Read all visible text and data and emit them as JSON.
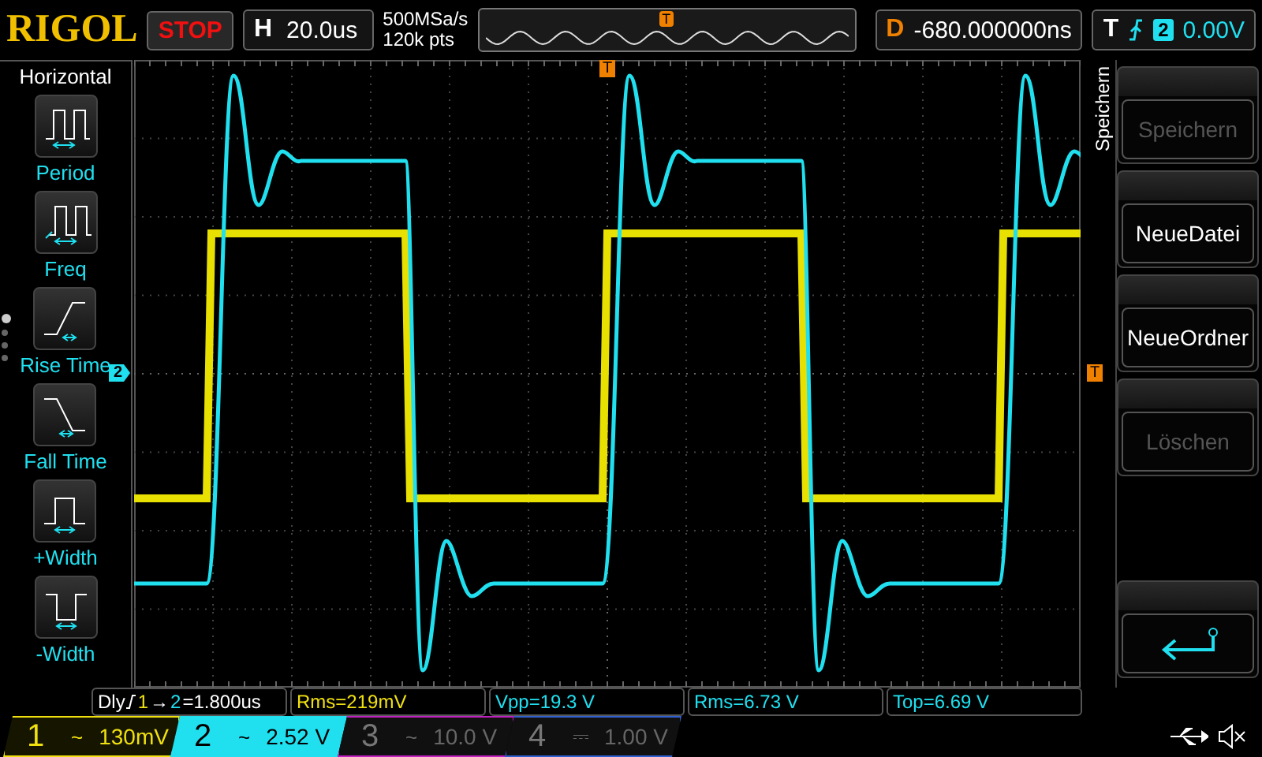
{
  "brand": "RIGOL",
  "run_state": "STOP",
  "horizontal": {
    "label": "H",
    "timebase": "20.0us"
  },
  "acquisition": {
    "sample_rate": "500MSa/s",
    "memory_depth": "120k pts"
  },
  "overview": {
    "trigger_marker": "T"
  },
  "delay": {
    "label": "D",
    "value": "-680.000000ns"
  },
  "trigger": {
    "label": "T",
    "source": "2",
    "trigger_level": "0.00V"
  },
  "left_menu": {
    "title": "Horizontal",
    "items": [
      {
        "kind": "period",
        "label": "Period"
      },
      {
        "kind": "freq",
        "label": "Freq"
      },
      {
        "kind": "rise",
        "label": "Rise Time"
      },
      {
        "kind": "fall",
        "label": "Fall Time"
      },
      {
        "kind": "pwidth",
        "label": "+Width"
      },
      {
        "kind": "nwidth",
        "label": "-Width"
      }
    ],
    "pages": [
      {
        "selected": true
      },
      {
        "selected": false
      },
      {
        "selected": false
      },
      {
        "selected": false
      }
    ]
  },
  "graticule": {
    "channel_marker": "2",
    "trigger_marker_top": "T",
    "trigger_marker_right": "T"
  },
  "right_menu": {
    "title": "Speichern",
    "buttons": [
      {
        "kind": "text",
        "label": "Speichern",
        "disabled": true
      },
      {
        "kind": "text",
        "label": "NeueDatei",
        "disabled": false
      },
      {
        "kind": "text",
        "label": "NeueOrdner",
        "disabled": false
      },
      {
        "kind": "text",
        "label": "Löschen",
        "disabled": true
      },
      {
        "kind": "enter",
        "disabled": false
      }
    ]
  },
  "measurements": [
    {
      "kind": "delay",
      "label": "Dly",
      "from": "1",
      "arrow": "→",
      "to": "2",
      "value": "=1.800us",
      "color": "#ffffff"
    },
    {
      "kind": "value",
      "text": "Rms=219mV",
      "color": "#f0e010"
    },
    {
      "kind": "value",
      "text": "Vpp=19.3 V",
      "color": "#20e0f0"
    },
    {
      "kind": "value",
      "text": "Rms=6.73 V",
      "color": "#20e0f0"
    },
    {
      "kind": "value",
      "text": "Top=6.69 V",
      "color": "#20e0f0"
    }
  ],
  "channels": [
    {
      "number": "1",
      "coupling": "~",
      "scale": "130mV",
      "color": "#f0e010",
      "enabled": true,
      "selected": false
    },
    {
      "number": "2",
      "coupling": "~",
      "scale": "2.52 V",
      "color": "#20e0f0",
      "enabled": true,
      "selected": true
    },
    {
      "number": "3",
      "coupling": "~",
      "scale": "10.0 V",
      "color": "#c020c0",
      "enabled": false,
      "selected": false
    },
    {
      "number": "4",
      "coupling": "⎓",
      "scale": "1.00 V",
      "color": "#3060d0",
      "enabled": false,
      "selected": false
    }
  ]
}
